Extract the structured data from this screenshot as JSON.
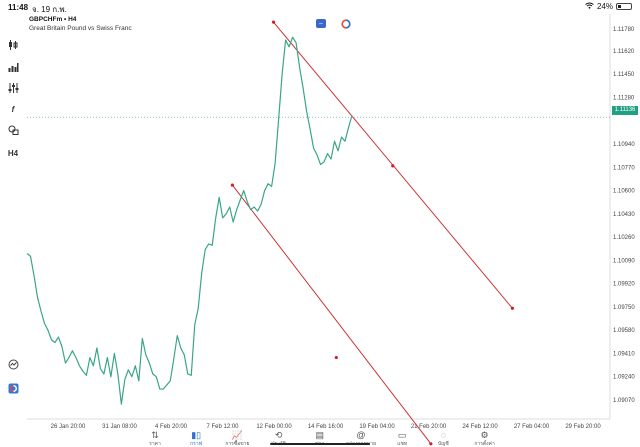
{
  "status_bar": {
    "time": "11:48",
    "date": "จ. 19 ก.พ.",
    "battery_label": "24%",
    "battery_level": 0.24
  },
  "header": {
    "symbol": "GBPCHFm • H4",
    "description": "Great Britain Pound vs Swiss Franc"
  },
  "toolbar_left": {
    "items": [
      "candles-icon",
      "bar-chart-icon",
      "indicators-icon",
      "f",
      "objects-icon",
      "H4"
    ],
    "bottom_items": [
      "search-icon",
      "settings-circle-icon"
    ]
  },
  "price_axis": {
    "labels": [
      "1.11780",
      "1.11620",
      "1.11450",
      "1.11280",
      "1.10940",
      "1.10770",
      "1.10600",
      "1.10430",
      "1.10260",
      "1.10090",
      "1.09920",
      "1.09750",
      "1.09580",
      "1.09410",
      "1.09240",
      "1.09070"
    ],
    "current_price": "1.11136"
  },
  "time_axis": {
    "labels": [
      "26 Jan 20:00",
      "31 Jan 08:00",
      "4 Feb 20:00",
      "7 Feb 12:00",
      "12 Feb 00:00",
      "14 Feb 16:00",
      "19 Feb 04:00",
      "21 Feb 20:00",
      "24 Feb 12:00",
      "27 Feb 04:00",
      "29 Feb 20:00"
    ]
  },
  "chart_data": {
    "type": "line",
    "title": "",
    "xlabel": "",
    "ylabel": "",
    "ylim": [
      1.0898,
      1.1186
    ],
    "x_ticks": [
      "26 Jan 20:00",
      "31 Jan 08:00",
      "4 Feb 20:00",
      "7 Feb 12:00",
      "12 Feb 00:00",
      "14 Feb 16:00",
      "19 Feb 04:00",
      "21 Feb 20:00",
      "24 Feb 12:00",
      "27 Feb 04:00",
      "29 Feb 20:00"
    ],
    "y_ticks": [
      1.1178,
      1.1162,
      1.1145,
      1.1128,
      1.1094,
      1.1077,
      1.106,
      1.1043,
      1.1026,
      1.1009,
      1.0992,
      1.0975,
      1.0958,
      1.0941,
      1.0924,
      1.0907
    ],
    "series": [
      {
        "color": "#3aa58a",
        "values": [
          1.1014,
          1.1012,
          1.0998,
          1.0982,
          1.0972,
          1.0963,
          1.0958,
          1.0951,
          1.0949,
          1.0953,
          1.0946,
          1.0934,
          1.0938,
          1.0943,
          1.0938,
          1.0932,
          1.0928,
          1.0925,
          1.0938,
          1.0932,
          1.0945,
          1.093,
          1.0926,
          1.0938,
          1.0924,
          1.0941,
          1.0926,
          1.0904,
          1.0922,
          1.0929,
          1.0924,
          1.0932,
          1.0921,
          1.0952,
          1.094,
          1.0934,
          1.0926,
          1.0924,
          1.0915,
          1.0915,
          1.0918,
          1.0921,
          1.0937,
          1.0954,
          1.0945,
          1.094,
          1.0926,
          1.0925,
          1.0962,
          1.0974,
          1.1,
          1.1017,
          1.1021,
          1.102,
          1.104,
          1.1055,
          1.104,
          1.1043,
          1.1048,
          1.1037,
          1.1046,
          1.1053,
          1.106,
          1.1052,
          1.1046,
          1.1048,
          1.1045,
          1.105,
          1.106,
          1.1065,
          1.1063,
          1.108,
          1.1112,
          1.1145,
          1.117,
          1.1165,
          1.1172,
          1.1168,
          1.115,
          1.1135,
          1.1118,
          1.1105,
          1.1091,
          1.1086,
          1.1079,
          1.1081,
          1.1087,
          1.1083,
          1.1096,
          1.1089,
          1.1099,
          1.1096,
          1.1106,
          1.1115
        ]
      }
    ],
    "current_price": 1.11136,
    "drawn_lines": [
      {
        "color": "#cc2222",
        "points": [
          [
            0.4258,
            1.1183
          ],
          [
            0.6317,
            1.1078
          ],
          [
            0.8383,
            1.0974
          ]
        ]
      },
      {
        "color": "#cc2222",
        "points": [
          [
            0.3547,
            1.1064
          ],
          [
            0.5342,
            1.0938
          ],
          [
            0.6975,
            1.0875
          ]
        ]
      }
    ],
    "grid": false,
    "legend": "none"
  },
  "bottom_nav": [
    {
      "label": "ราคา",
      "icon": "quotes-icon",
      "active": false
    },
    {
      "label": "กราฟ",
      "icon": "chart-icon",
      "active": true
    },
    {
      "label": "การซื้อขาย",
      "icon": "trade-icon",
      "active": false
    },
    {
      "label": "ประวัติ",
      "icon": "history-icon",
      "active": false
    },
    {
      "label": "ข่าว",
      "icon": "news-icon",
      "active": false
    },
    {
      "label": "กล่องจดหมาย",
      "icon": "mailbox-icon",
      "active": false
    },
    {
      "label": "แชท",
      "icon": "chat-icon",
      "active": false
    },
    {
      "label": "บัญชี",
      "icon": "account-icon",
      "active": false
    },
    {
      "label": "การตั้งค่า",
      "icon": "settings-icon",
      "active": false
    }
  ]
}
